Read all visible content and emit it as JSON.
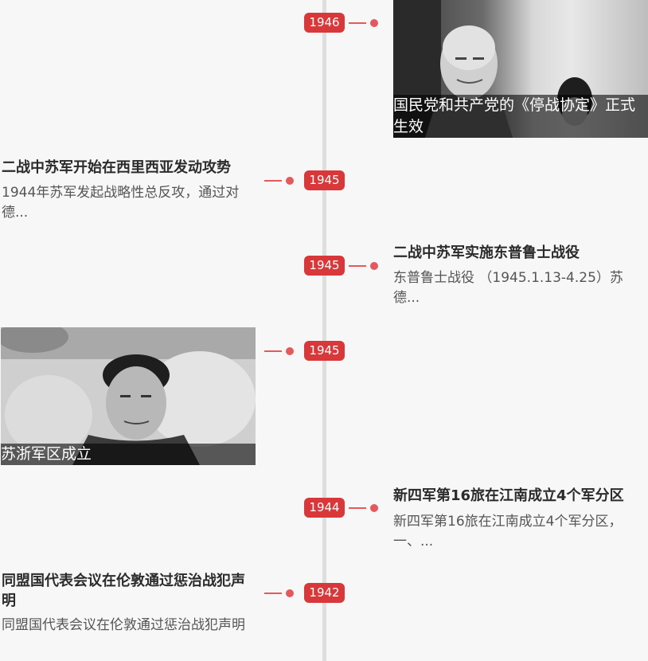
{
  "events": [
    {
      "year": "1946",
      "side": "right",
      "type": "photo",
      "caption": "国民党和共产党的《停战协定》正式生效"
    },
    {
      "year": "1945",
      "side": "left",
      "type": "text",
      "title": "二战中苏军开始在西里西亚发动攻势",
      "desc": "1944年苏军发起战略性总反攻，通过对德..."
    },
    {
      "year": "1945",
      "side": "right",
      "type": "text",
      "title": "二战中苏军实施东普鲁士战役",
      "desc": "东普鲁士战役 （1945.1.13-4.25）苏德..."
    },
    {
      "year": "1945",
      "side": "left",
      "type": "photo",
      "caption": "苏浙军区成立"
    },
    {
      "year": "1944",
      "side": "right",
      "type": "text",
      "title": "新四军第16旅在江南成立4个军分区",
      "desc": "新四军第16旅在江南成立4个军分区，一、..."
    },
    {
      "year": "1942",
      "side": "left",
      "type": "text",
      "title": "同盟国代表会议在伦敦通过惩治战犯声明",
      "desc": "同盟国代表会议在伦敦通过惩治战犯声明"
    }
  ],
  "colors": {
    "accent": "#d9383a",
    "axis": "#dedede",
    "background": "#f7f7f7"
  }
}
